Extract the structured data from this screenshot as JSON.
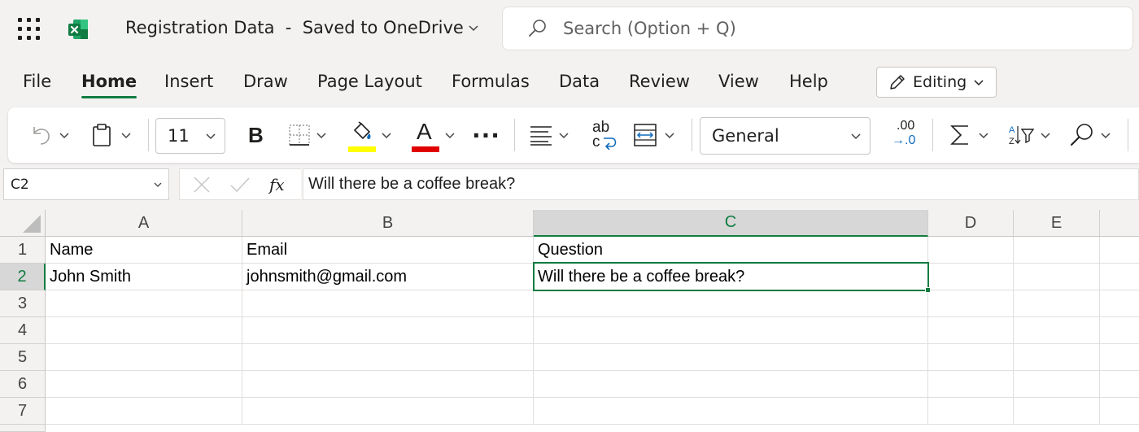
{
  "app": {
    "doc_title": "Registration Data  -  Saved to OneDrive",
    "search_placeholder": "Search (Option + Q)",
    "accent": "#107c41"
  },
  "tabs": [
    {
      "label": "File"
    },
    {
      "label": "Home"
    },
    {
      "label": "Insert"
    },
    {
      "label": "Draw"
    },
    {
      "label": "Page Layout"
    },
    {
      "label": "Formulas"
    },
    {
      "label": "Data"
    },
    {
      "label": "Review"
    },
    {
      "label": "View"
    },
    {
      "label": "Help"
    }
  ],
  "active_tab": "Home",
  "editing_mode": "Editing",
  "ribbon": {
    "font_size": "11",
    "bold_label": "B",
    "font_color_label": "A",
    "wrap_label_top": "ab",
    "wrap_label_bottom": "c",
    "number_format": "General",
    "decimal_top": ".00",
    "decimal_bottom": "→.0",
    "more_label": "···",
    "highlight_color": "#ffff00",
    "font_color": "#e00000",
    "icons": [
      "undo-icon",
      "paste-icon",
      "borders-icon",
      "fill-color-icon",
      "font-color-icon",
      "more-icon",
      "align-icon",
      "wrap-text-icon",
      "merge-icon",
      "decimal-icon",
      "autosum-icon",
      "sort-filter-icon",
      "find-icon"
    ]
  },
  "formula_bar": {
    "name_box": "C2",
    "fx_label": "fx",
    "formula": "Will there be a coffee break?"
  },
  "grid": {
    "columns": [
      "A",
      "B",
      "C",
      "D",
      "E"
    ],
    "rows": [
      "1",
      "2",
      "3",
      "4",
      "5",
      "6",
      "7"
    ],
    "selected_column": "C",
    "selected_row": "2",
    "cells": {
      "A1": "Name",
      "B1": "Email",
      "C1": "Question",
      "A2": "John Smith",
      "B2": "johnsmith@gmail.com",
      "C2": "Will there be a coffee break?"
    }
  }
}
